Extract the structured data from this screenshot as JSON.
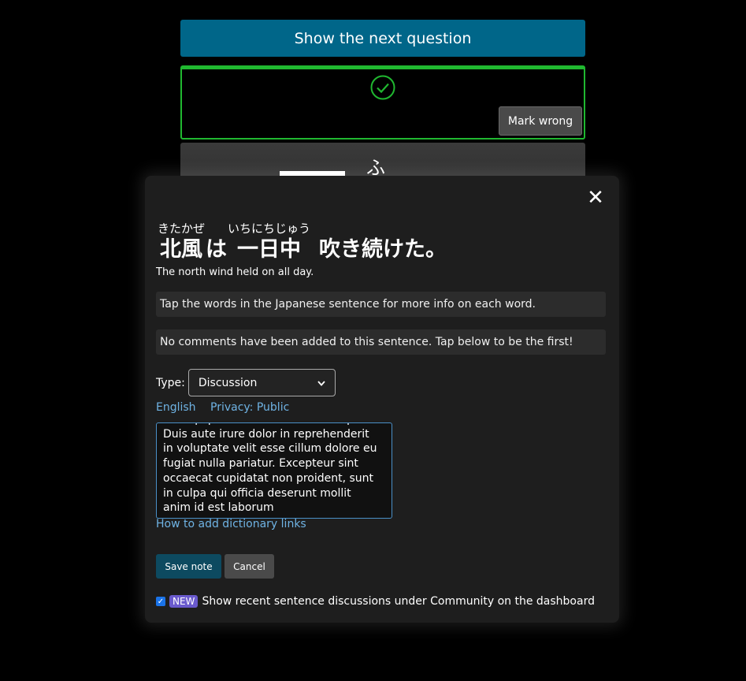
{
  "next_button": {
    "label": "Show the next question"
  },
  "result_card": {
    "mark_wrong_label": "Mark wrong",
    "accent_color": "#20b830"
  },
  "kanji_card": {
    "kana": "ふ"
  },
  "modal": {
    "close_glyph": "✕",
    "sentence_segments": [
      {
        "reading": "きたかぜ",
        "text": "北風"
      },
      {
        "reading": "",
        "text": "は"
      },
      {
        "reading": "いちにちじゅう",
        "text": "一日中"
      },
      {
        "reading": "",
        "text": "吹き続けた。"
      }
    ],
    "translation": "The north wind held on all day.",
    "tap_hint": "Tap the words in the Japanese sentence for more info on each word.",
    "comments_status": "No comments have been added to this sentence. Tap below to be the first!",
    "type_label": "Type:",
    "type_selected": "Discussion",
    "language_link": "English",
    "privacy_link": "Privacy: Public",
    "note_text": "ut aliquip ex ea commodo consequat. Duis aute irure dolor in reprehenderit in voluptate velit esse cillum dolore eu fugiat nulla pariatur. Excepteur sint occaecat cupidatat non proident, sunt in culpa qui officia deserunt mollit anim id est laborum",
    "help_link": "How to add dictionary links",
    "save_label": "Save note",
    "cancel_label": "Cancel",
    "new_badge": "NEW",
    "dashboard_option": "Show recent sentence discussions under Community on the dashboard",
    "dashboard_checked": true
  }
}
